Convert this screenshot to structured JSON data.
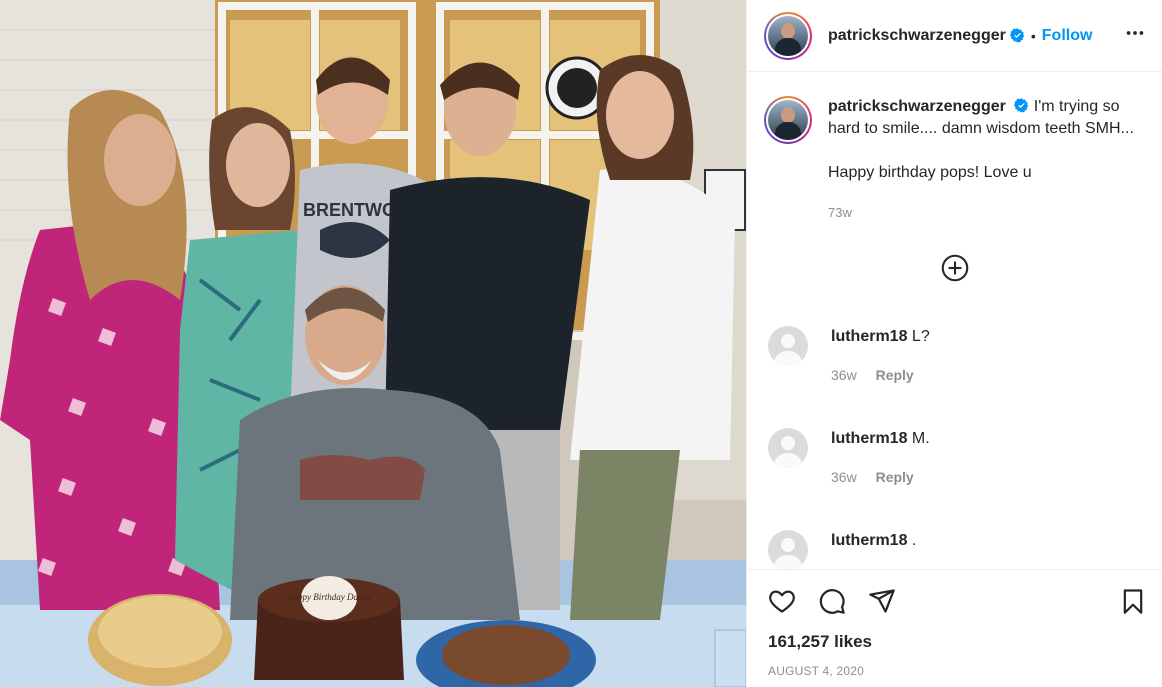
{
  "post": {
    "photo_alt": "Family group photo around a birthday cake",
    "cake_topper_text": "Happy Birthday Daddy",
    "shirt_text": "BRENTWOOD"
  },
  "header": {
    "username": "patrickschwarzenegger",
    "separator": "•",
    "follow_label": "Follow",
    "more_label": "•••"
  },
  "caption": {
    "username": "patrickschwarzenegger",
    "line1": "I'm trying so hard to smile.... damn wisdom teeth SMH...",
    "line2": "Happy birthday pops! Love u",
    "age": "73w"
  },
  "comments": [
    {
      "username": "lutherm18",
      "text": "L?",
      "age": "36w",
      "reply_label": "Reply"
    },
    {
      "username": "lutherm18",
      "text": "M.",
      "age": "36w",
      "reply_label": "Reply"
    },
    {
      "username": "lutherm18",
      "text": ".",
      "age": "",
      "reply_label": ""
    }
  ],
  "footer": {
    "likes": "161,257 likes",
    "date": "AUGUST 4, 2020"
  },
  "colors": {
    "accent": "#0095f6",
    "muted": "#8e8e8e",
    "text": "#262626"
  },
  "icons": [
    "verified-icon",
    "more-icon",
    "add-comment-icon",
    "heart-icon",
    "comment-icon",
    "share-icon",
    "save-icon"
  ]
}
